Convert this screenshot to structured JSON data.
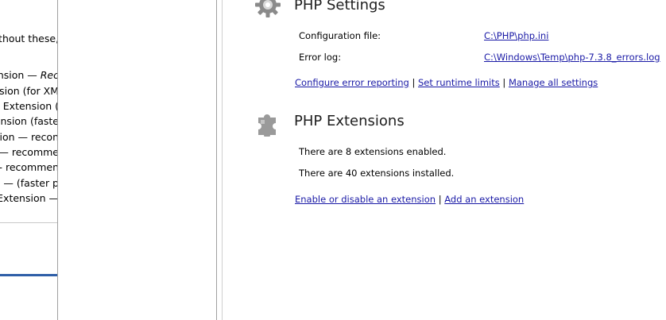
{
  "left_pane": {
    "lines": [
      "without these,",
      "ension — Rec",
      "nsion (for XM",
      "Extension (",
      "ension (faste",
      "sion — recon",
      "— recomme",
      "- recommen",
      "n — (faster p",
      "Extension —"
    ]
  },
  "php_settings": {
    "title": "PHP Settings",
    "icon": "gear-icon",
    "config_label": "Configuration file:",
    "config_value": "C:\\PHP\\php.ini",
    "errorlog_label": "Error log:",
    "errorlog_value": "C:\\Windows\\Temp\\php-7.3.8_errors.log",
    "links": {
      "configure_error": "Configure error reporting",
      "runtime_limits": "Set runtime limits",
      "manage_all": "Manage all settings"
    }
  },
  "php_extensions": {
    "title": "PHP Extensions",
    "icon": "puzzle-icon",
    "enabled_text": "There are 8 extensions enabled.",
    "installed_text": "There are 40 extensions installed.",
    "links": {
      "enable_disable": "Enable or disable an extension",
      "add": "Add an extension"
    }
  },
  "colors": {
    "link": "#1a1aa6",
    "accent_bar": "#2f5fa8"
  }
}
